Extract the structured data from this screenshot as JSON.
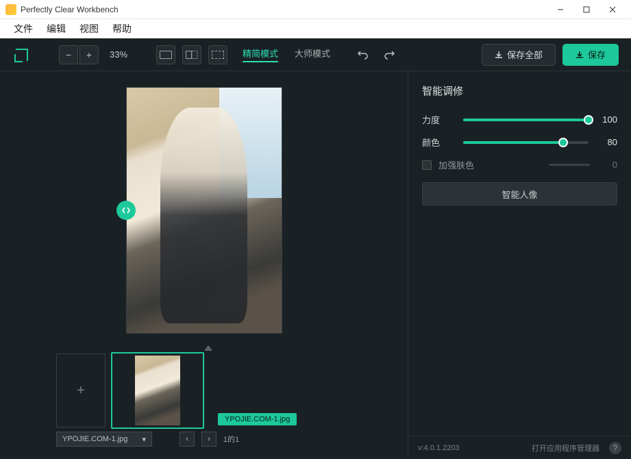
{
  "window": {
    "title": "Perfectly Clear Workbench"
  },
  "menu": {
    "file": "文件",
    "edit": "编辑",
    "view": "视图",
    "help": "帮助"
  },
  "toolbar": {
    "zoom": "33%",
    "mode_simple": "精简模式",
    "mode_master": "大师模式",
    "save_all": "保存全部",
    "save": "保存"
  },
  "tray": {
    "filename_label": "YPOJIE.COM-1.jpg",
    "selected_file": "YPOJIE.COM-1.jpg",
    "page_info": "1的1"
  },
  "panel": {
    "title": "智能调修",
    "strength_label": "力度",
    "strength_value": "100",
    "color_label": "颜色",
    "color_value": "80",
    "enhance_skin": "加强肤色",
    "enhance_skin_value": "0",
    "action_button": "智能人像"
  },
  "status": {
    "version": "v:4.0.1.2203",
    "manager": "打开应用程序管理器"
  }
}
